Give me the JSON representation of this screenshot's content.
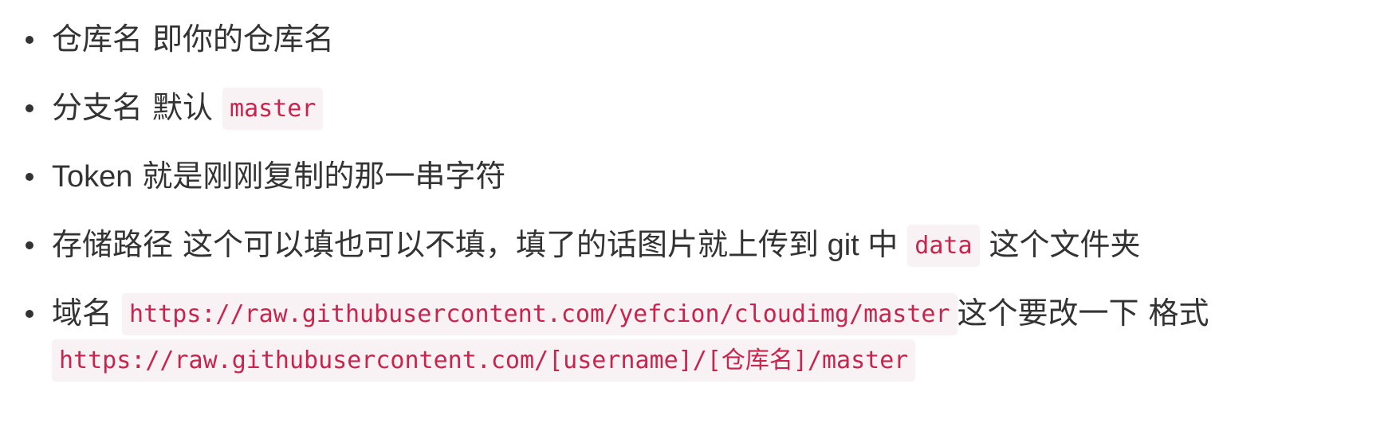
{
  "list": {
    "items": [
      {
        "text1": "仓库名",
        "text2": "即你的仓库名"
      },
      {
        "text1": "分支名",
        "text2": "默认",
        "code": "master"
      },
      {
        "text1": "Token",
        "text2": "就是刚刚复制的那一串字符"
      },
      {
        "text1": "存储路径",
        "text2": "这个可以填也可以不填，填了的话图片就上传到 git 中",
        "code": "data",
        "text3": "这个文件夹"
      },
      {
        "text1": "域名",
        "code": "https://raw.githubusercontent.com/yefcion/cloudimg/master",
        "text2": "这个要改一下",
        "text3": "格式",
        "code2": "https://raw.githubusercontent.com/[username]/[仓库名]/master"
      }
    ]
  },
  "colors": {
    "text": "#333333",
    "code_text": "#c7254e",
    "code_bg": "#f9f2f4",
    "background": "#ffffff"
  }
}
